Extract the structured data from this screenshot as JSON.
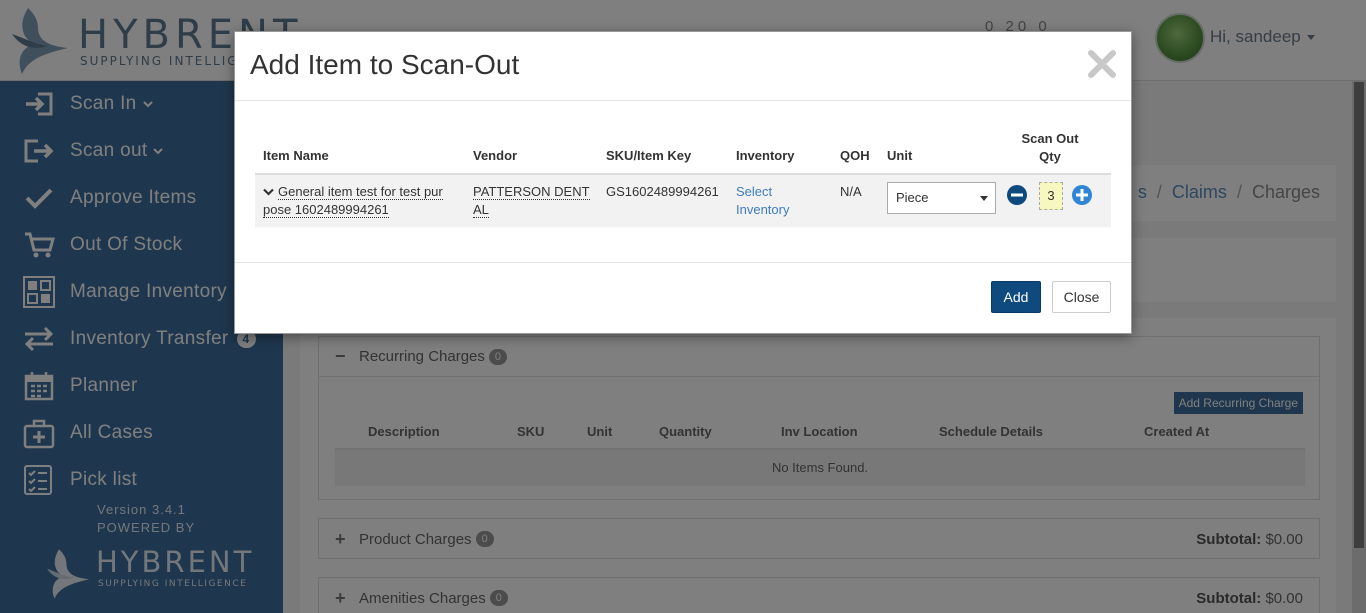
{
  "header": {
    "brand_name": "HYBRENT",
    "brand_tagline": "SUPPLYING INTELLIGENCE",
    "counts": "0  20  0",
    "user_greeting": "Hi, sandeep"
  },
  "sidebar": {
    "items": [
      {
        "label": "Scan In",
        "icon": "scan-in-icon",
        "has_caret": true
      },
      {
        "label": "Scan out",
        "icon": "scan-out-icon",
        "has_caret": true
      },
      {
        "label": "Approve Items",
        "icon": "check-icon"
      },
      {
        "label": "Out Of Stock",
        "icon": "cart-icon"
      },
      {
        "label": "Manage Inventory",
        "icon": "inventory-grid-icon"
      },
      {
        "label": "Inventory Transfer",
        "icon": "transfer-arrows-icon",
        "badge": "4"
      },
      {
        "label": "Planner",
        "icon": "calendar-icon"
      },
      {
        "label": "All Cases",
        "icon": "medical-case-icon"
      },
      {
        "label": "Pick list",
        "icon": "checklist-icon"
      }
    ],
    "version": "Version 3.4.1",
    "powered_by": "POWERED BY",
    "footer_brand": "HYBRENT",
    "footer_tagline": "SUPPLYING INTELLIGENCE"
  },
  "breadcrumb": {
    "items": [
      "s",
      "Claims",
      "Charges"
    ]
  },
  "panels": {
    "recurring": {
      "title": "Recurring Charges",
      "count": "0",
      "add_button": "Add Recurring Charge",
      "columns": [
        "Description",
        "SKU",
        "Unit",
        "Quantity",
        "Inv Location",
        "Schedule Details",
        "Created At"
      ],
      "empty_text": "No Items Found."
    },
    "product": {
      "title": "Product Charges",
      "count": "0",
      "subtotal_label": "Subtotal:",
      "subtotal_value": "$0.00"
    },
    "amenities": {
      "title": "Amenities Charges",
      "count": "0",
      "subtotal_label": "Subtotal:",
      "subtotal_value": "$0.00"
    }
  },
  "modal": {
    "title": "Add Item to Scan-Out",
    "columns": {
      "item_name": "Item Name",
      "vendor": "Vendor",
      "sku": "SKU/Item Key",
      "inventory": "Inventory",
      "qoh": "QOH",
      "unit": "Unit",
      "scan_out_qty_line1": "Scan Out",
      "scan_out_qty_line2": "Qty"
    },
    "row": {
      "item_name": "General item test for test pur pose 1602489994261",
      "vendor": "PATTERSON DENT AL",
      "sku": "GS1602489994261",
      "inventory_link": "Select Inventory",
      "qoh": "N/A",
      "unit": "Piece",
      "qty": "3"
    },
    "add_button": "Add",
    "close_button": "Close"
  },
  "colors": {
    "sidebar": "#3d6e9d",
    "primary_button": "#0e4a7e",
    "link": "#3d7dbf",
    "qty_highlight": "#f7f7c0"
  }
}
